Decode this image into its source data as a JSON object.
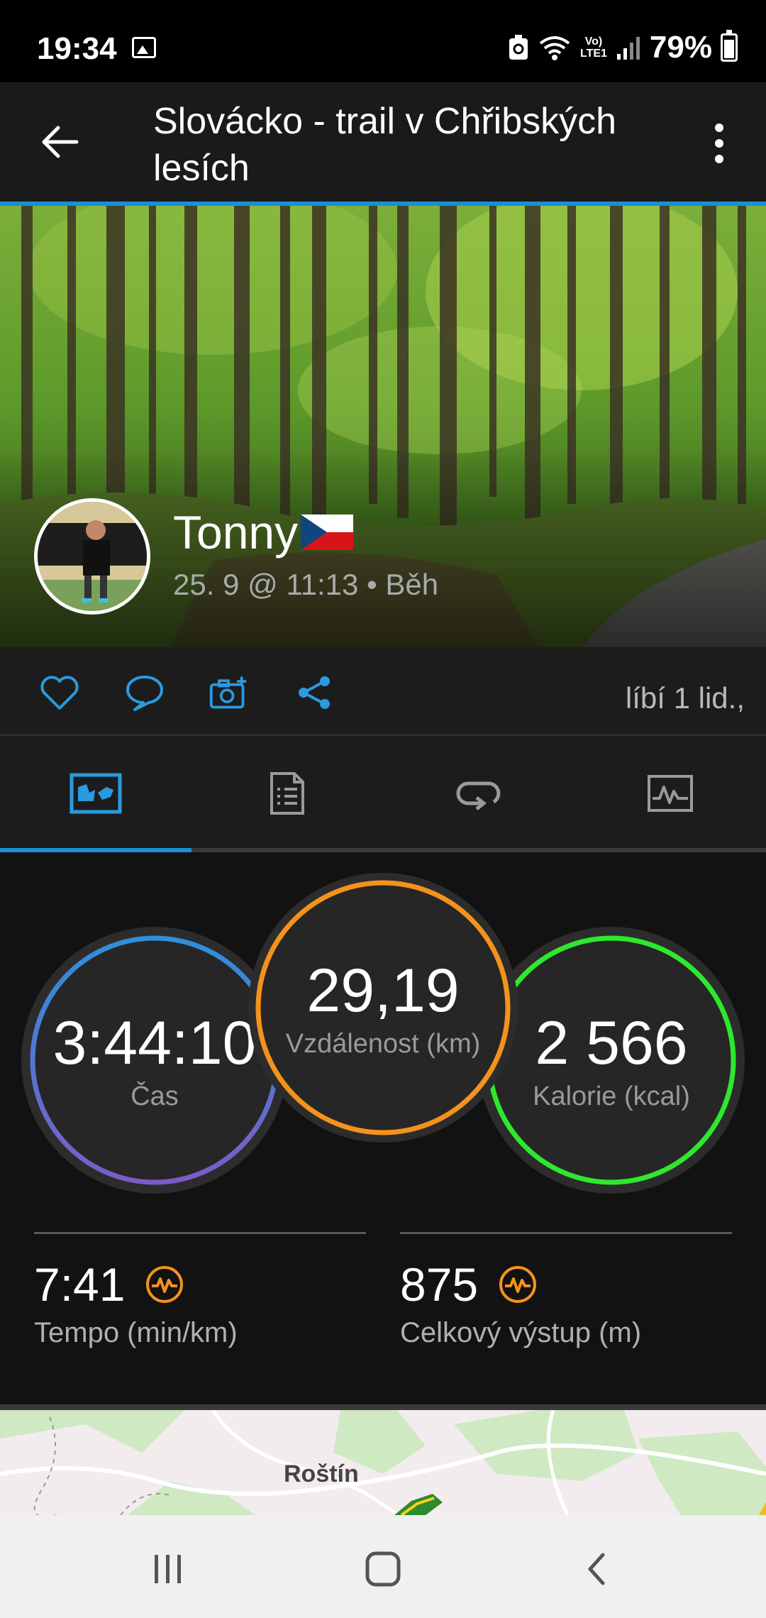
{
  "status_bar": {
    "time": "19:34",
    "battery_percent": "79%",
    "network": "LTE1",
    "icons": [
      "image-icon",
      "recycle-icon",
      "wifi-icon",
      "volte-icon",
      "signal-icon",
      "battery-icon"
    ]
  },
  "header": {
    "title": "Slovácko - trail v Chřibských lesích",
    "back_icon": "back-arrow-icon",
    "menu_icon": "more-vert-icon"
  },
  "activity": {
    "user_name": "Tonny",
    "flag": "czech-flag",
    "meta": "25. 9 @ 11:13 • Běh"
  },
  "actions": {
    "icons": [
      "heart-icon",
      "comment-icon",
      "add-photo-icon",
      "share-icon"
    ],
    "likes_text": "líbí 1 lid.,"
  },
  "tabs": [
    {
      "name": "overview",
      "icon": "map-overview-icon",
      "active": true
    },
    {
      "name": "details",
      "icon": "document-icon",
      "active": false
    },
    {
      "name": "laps",
      "icon": "laps-icon",
      "active": false
    },
    {
      "name": "charts",
      "icon": "chart-icon",
      "active": false
    }
  ],
  "stats": {
    "time": {
      "value": "3:44:10",
      "label": "Čas"
    },
    "distance": {
      "value": "29,19",
      "label": "Vzdálenost (km)"
    },
    "calories": {
      "value": "2 566",
      "label": "Kalorie (kcal)"
    },
    "pace": {
      "value": "7:41",
      "label": "Tempo (min/km)"
    },
    "ascent": {
      "value": "875",
      "label": "Celkový výstup (m)"
    }
  },
  "map": {
    "label": "Roštín"
  },
  "colors": {
    "accent_blue": "#1a8fd8",
    "distance_orange": "#f4921e",
    "calories_green": "#2ee82e",
    "time_blue": "#2f8fd8",
    "time_purple": "#7a5cc8"
  }
}
